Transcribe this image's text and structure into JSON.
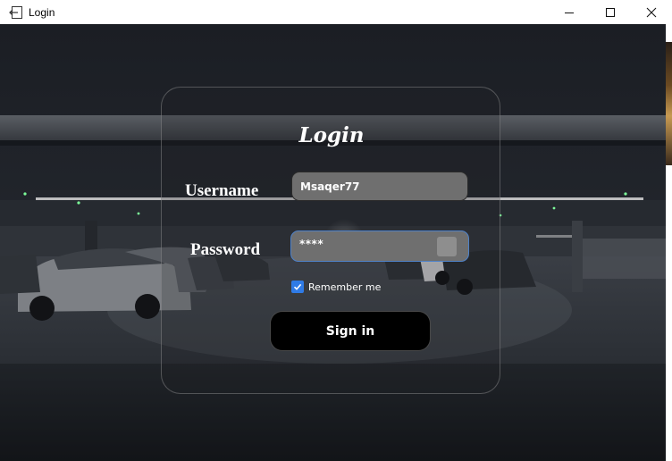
{
  "window": {
    "title": "Login",
    "icon": "back-arrow-icon",
    "controls": [
      "minimize-icon",
      "maximize-icon",
      "close-icon"
    ]
  },
  "form": {
    "heading": "Login",
    "username_label": "Username",
    "username_value": "Msaqer77",
    "password_label": "Password",
    "password_value": "****",
    "remember_label": "Remember me",
    "remember_checked": true,
    "signin_label": "Sign in"
  },
  "colors": {
    "input_bg": "#6f6f6f",
    "focus_border": "#4f82c8",
    "checkbox": "#2f7be6",
    "button_bg": "#000000"
  }
}
